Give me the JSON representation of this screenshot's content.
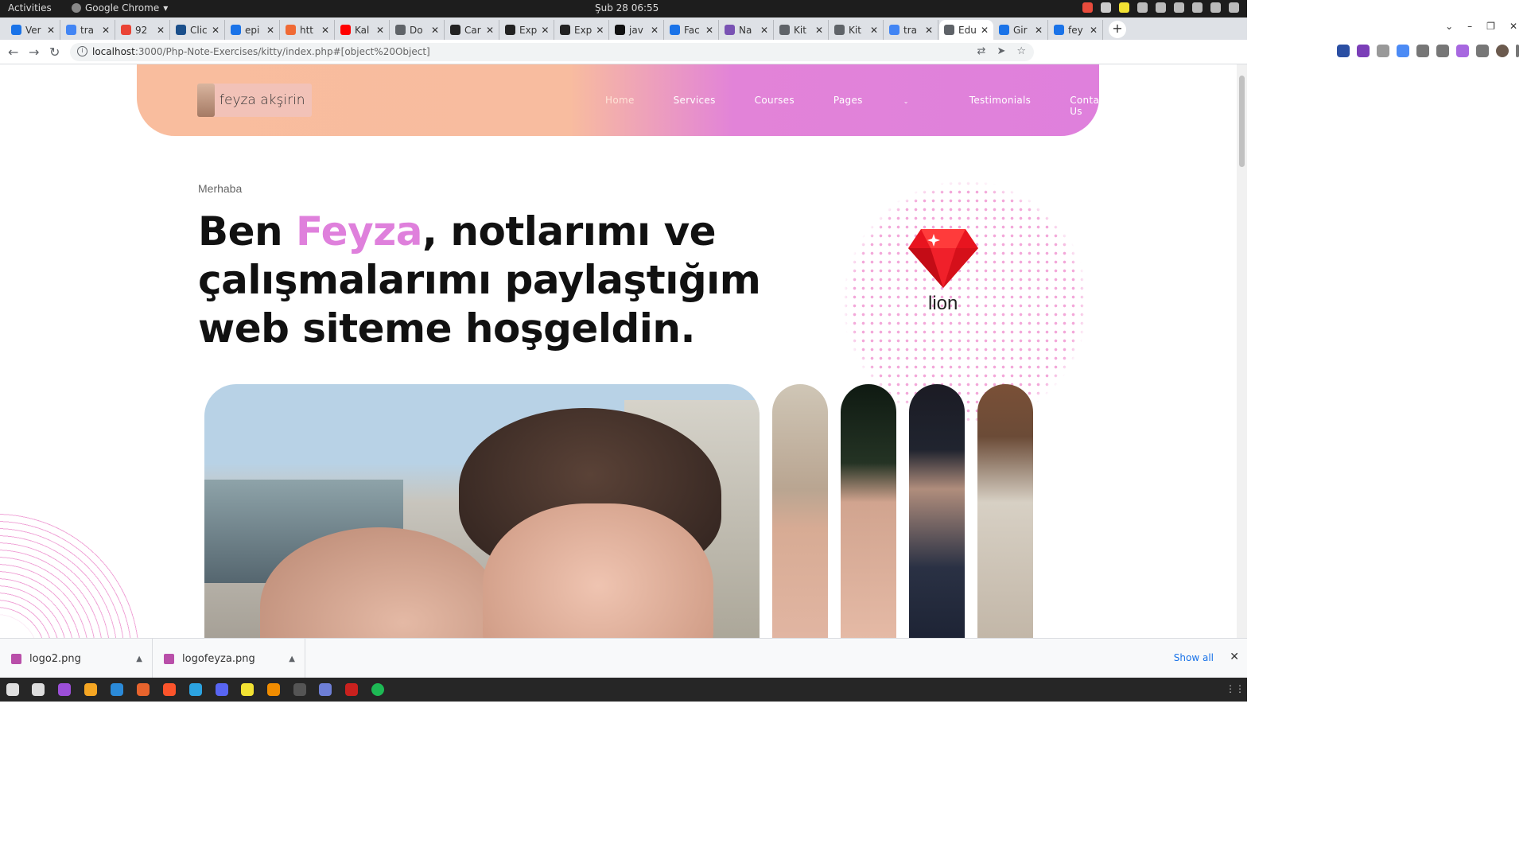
{
  "os": {
    "activities": "Activities",
    "app_name": "Google Chrome",
    "clock": "Şub 28  06:55"
  },
  "browser": {
    "tabs": [
      {
        "label": "Ver",
        "color": "#1a73e8"
      },
      {
        "label": "tra",
        "color": "#4285f4"
      },
      {
        "label": "92",
        "color": "#ea4335"
      },
      {
        "label": "Clic",
        "color": "#1a4f8b"
      },
      {
        "label": "epi",
        "color": "#1a73e8"
      },
      {
        "label": "htt",
        "color": "#f06a35"
      },
      {
        "label": "Kal",
        "color": "#ff0000"
      },
      {
        "label": "Do",
        "color": "#5f6368"
      },
      {
        "label": "Car",
        "color": "#222222"
      },
      {
        "label": "Exp",
        "color": "#222222"
      },
      {
        "label": "Exp",
        "color": "#222222"
      },
      {
        "label": "jav",
        "color": "#111111"
      },
      {
        "label": "Fac",
        "color": "#1a73e8"
      },
      {
        "label": "Na",
        "color": "#7952b3"
      },
      {
        "label": "Kit",
        "color": "#5f6368"
      },
      {
        "label": "Kit",
        "color": "#5f6368"
      },
      {
        "label": "tra",
        "color": "#4285f4"
      },
      {
        "label": "Edu",
        "color": "#5f6368"
      },
      {
        "label": "Gir",
        "color": "#1a73e8"
      },
      {
        "label": "fey",
        "color": "#1a73e8"
      }
    ],
    "active_tab_index": 17,
    "url_host": "localhost",
    "url_rest": ":3000/Php-Note-Exercises/kitty/index.php#[object%20Object]"
  },
  "site": {
    "logo_text": "feyza akşirin",
    "nav": {
      "home": "Home",
      "services": "Services",
      "courses": "Courses",
      "pages": "Pages",
      "testimonials": "Testimonials",
      "contact": "Contact Us"
    },
    "greeting": "Merhaba",
    "headline_pre": "Ben ",
    "headline_name": "Feyza",
    "headline_post": ", notlarımı ve çalışmalarımı paylaştığım web siteme hoşgeldin.",
    "badge_caption": "lion",
    "colors": {
      "brand_pink": "#df80dc",
      "header_peach": "#f9bd9e"
    }
  },
  "downloads": {
    "items": [
      "logo2.png",
      "logofeyza.png"
    ],
    "show_all": "Show all"
  }
}
